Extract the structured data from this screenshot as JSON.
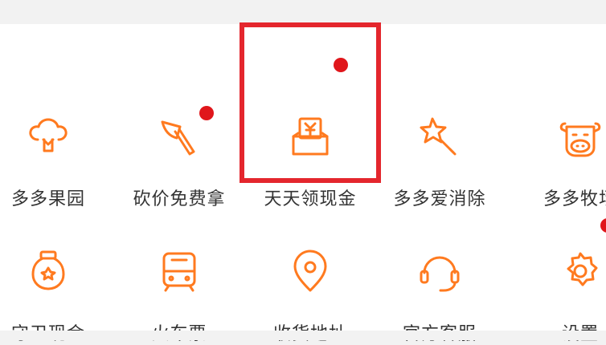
{
  "accent_color": "#ff7a1f",
  "badge_color": "#e0161b",
  "highlight_color": "#e4262d",
  "row1": [
    {
      "label": "多多果园",
      "icon": "tree-icon",
      "badge": false
    },
    {
      "label": "砍价免费拿",
      "icon": "axe-icon",
      "badge": true
    },
    {
      "label": "天天领现金",
      "icon": "cash-box-icon",
      "badge": true
    },
    {
      "label": "多多爱消除",
      "icon": "star-wand-icon",
      "badge": false
    },
    {
      "label": "多多牧场",
      "icon": "cow-icon",
      "badge": false
    }
  ],
  "row2": [
    {
      "label": "守卫现金",
      "icon": "jar-icon",
      "badge": false
    },
    {
      "label": "火车票",
      "icon": "train-icon",
      "badge": false
    },
    {
      "label": "收货地址",
      "icon": "location-pin-icon",
      "badge": false
    },
    {
      "label": "官方客服",
      "icon": "headset-icon",
      "badge": false
    },
    {
      "label": "设置",
      "icon": "gear-icon",
      "badge": true
    }
  ]
}
